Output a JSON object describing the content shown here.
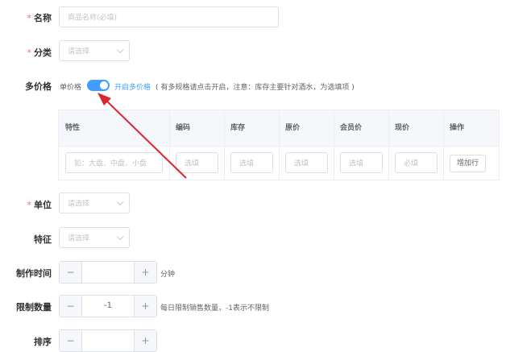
{
  "form": {
    "name": {
      "label": "名称",
      "required": "*",
      "placeholder": "商品名称(必填)"
    },
    "category": {
      "label": "分类",
      "required": "*",
      "placeholder": "请选择"
    },
    "multi_price": {
      "label": "多价格",
      "switch_off_text": "单价格",
      "switch_on_text": "开启多价格",
      "hint": "( 有多规格请点击开启，注意：库存主要针对酒水，为选填项 )",
      "enabled": true
    },
    "spec_table": {
      "headers": [
        "特性",
        "编码",
        "库存",
        "原价",
        "会员价",
        "现价",
        "操作"
      ],
      "row_placeholders": [
        "如：大盘、中盘、小盘",
        "选填",
        "选填",
        "选填",
        "选填",
        "必填"
      ],
      "add_row_label": "增加行"
    },
    "unit": {
      "label": "单位",
      "required": "*",
      "placeholder": "请选择"
    },
    "feature": {
      "label": "特征",
      "placeholder": "请选择"
    },
    "make_time": {
      "label": "制作时间",
      "minus": "−",
      "plus": "+",
      "value": "",
      "suffix": "分钟"
    },
    "limit_qty": {
      "label": "限制数量",
      "minus": "−",
      "plus": "+",
      "value": "-1",
      "suffix": "每日限制销售数量，-1表示不限制"
    },
    "sort": {
      "label": "排序",
      "minus": "−",
      "plus": "+",
      "value": ""
    }
  },
  "colors": {
    "accent": "#409eff",
    "required": "#f56c6c",
    "arrow": "#d9272e"
  }
}
